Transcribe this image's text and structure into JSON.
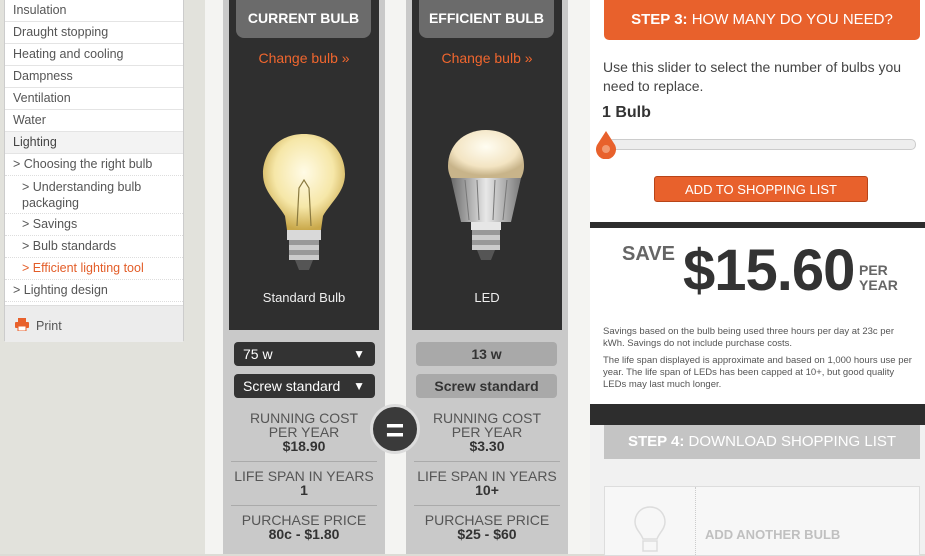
{
  "sidebar": {
    "items": [
      {
        "label": "Insulation"
      },
      {
        "label": "Draught stopping"
      },
      {
        "label": "Heating and cooling"
      },
      {
        "label": "Dampness"
      },
      {
        "label": "Ventilation"
      },
      {
        "label": "Water"
      },
      {
        "label": "Lighting"
      },
      {
        "label": "> Choosing the right bulb"
      },
      {
        "label": "> Understanding bulb packaging"
      },
      {
        "label": "> Savings"
      },
      {
        "label": "> Bulb standards"
      },
      {
        "label": "> Efficient lighting tool"
      },
      {
        "label": "> Lighting design"
      }
    ],
    "print_label": "Print"
  },
  "current": {
    "header": "CURRENT BULB",
    "change": "Change bulb »",
    "name": "Standard Bulb",
    "wattage": "75 w",
    "base": "Screw standard",
    "running_label_1": "RUNNING COST",
    "running_label_2": "PER YEAR",
    "running_value": "$18.90",
    "life_label": "LIFE SPAN IN YEARS",
    "life_value": "1",
    "price_label": "PURCHASE PRICE",
    "price_value": "80c - $1.80"
  },
  "efficient": {
    "header": "EFFICIENT BULB",
    "change": "Change bulb »",
    "name": "LED",
    "wattage": "13 w",
    "base": "Screw standard",
    "running_label_1": "RUNNING COST",
    "running_label_2": "PER YEAR",
    "running_value": "$3.30",
    "life_label": "LIFE SPAN IN YEARS",
    "life_value": "10+",
    "price_label": "PURCHASE PRICE",
    "price_value": "$25 - $60"
  },
  "equals_symbol": "=",
  "step3": {
    "label_bold": "STEP 3:",
    "label": " HOW MANY DO YOU NEED?",
    "instructions": "Use this slider to select the number of bulbs you need to replace.",
    "count": "1 Bulb",
    "slider_value": 1,
    "add_button": "ADD TO SHOPPING LIST"
  },
  "savings": {
    "save_label": "SAVE",
    "amount": "$15.60",
    "per_1": "PER",
    "per_2": "YEAR",
    "note_1": "Savings based on the bulb being used three hours per day at 23c per kWh. Savings do not include purchase costs.",
    "note_2": "The life span displayed is approximate and based on 1,000 hours use per year. The life span of LEDs has been capped at 10+, but good quality LEDs may last much longer."
  },
  "step4": {
    "label_bold": "STEP 4:",
    "label": " DOWNLOAD SHOPPING LIST",
    "add_another": "ADD ANOTHER BULB"
  },
  "colors": {
    "accent": "#e8612c",
    "dark": "#2f2f2f"
  }
}
